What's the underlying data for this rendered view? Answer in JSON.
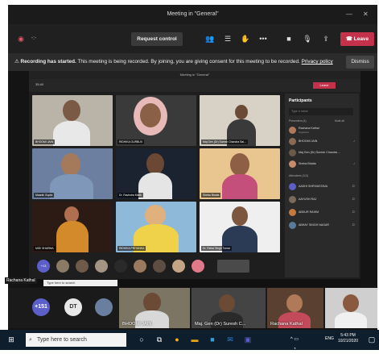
{
  "window": {
    "title": "Meeting in \"General\""
  },
  "toolbar": {
    "request_control": "Request control",
    "leave": "Leave"
  },
  "banner": {
    "title": "Recording has started.",
    "text": "This meeting is being recorded. By joining, you are giving consent for this meeting to be recorded.",
    "link": "Privacy policy",
    "dismiss": "Dismiss"
  },
  "inner": {
    "title": "Meeting in \"General\"",
    "timer": "35:40",
    "leave": "Leave",
    "tiles": [
      {
        "label": "BHOOMI JAIN"
      },
      {
        "label": "RIDHIKA GURBUX"
      },
      {
        "label": "Maj Gen (Dr) Suresh Chandra Sai..."
      },
      {
        "label": "Maanik Gupta"
      },
      {
        "label": "Dr. Ravindra Malik"
      },
      {
        "label": "Sheba Bhatia"
      },
      {
        "label": "MIDI SHARMA"
      },
      {
        "label": "RIDHIKA PRIYANKA"
      },
      {
        "label": "Dr. Rahul Singh Tomar"
      }
    ],
    "strip_badge": "+13",
    "panel": {
      "title": "Participants",
      "search": "Type a name",
      "presenters": "Presenters (4)",
      "mute_all": "Mute all",
      "attendees": "Attendees (113)",
      "people": [
        {
          "name": "Rachana Kathal",
          "sub": "Organizer"
        },
        {
          "name": "BHOOMI JAIN"
        },
        {
          "name": "Maj Gen (Dr) Suresh Chandra ..."
        },
        {
          "name": "Sheba Bhatia"
        },
        {
          "name": "AADHI SHRIVASTAVA"
        },
        {
          "name": "AAYUSH RAJ"
        },
        {
          "name": "ABDUR RAHIM"
        },
        {
          "name": "ABHAY SINGH NAGAR"
        }
      ]
    },
    "taskbar": {
      "presenter": "Rachana Kathal",
      "search": "Type here to search"
    }
  },
  "bottom": {
    "badge_count": "+151",
    "badge_initials": "DT",
    "names": [
      "BHOOMI JAIN",
      "Maj. Gen (Dr) Suresh C...",
      "Rachana Kathal"
    ]
  },
  "taskbar": {
    "search": "Type here to search",
    "lang": "ENG",
    "time": "5:43 PM",
    "date": "10/21/2020"
  }
}
